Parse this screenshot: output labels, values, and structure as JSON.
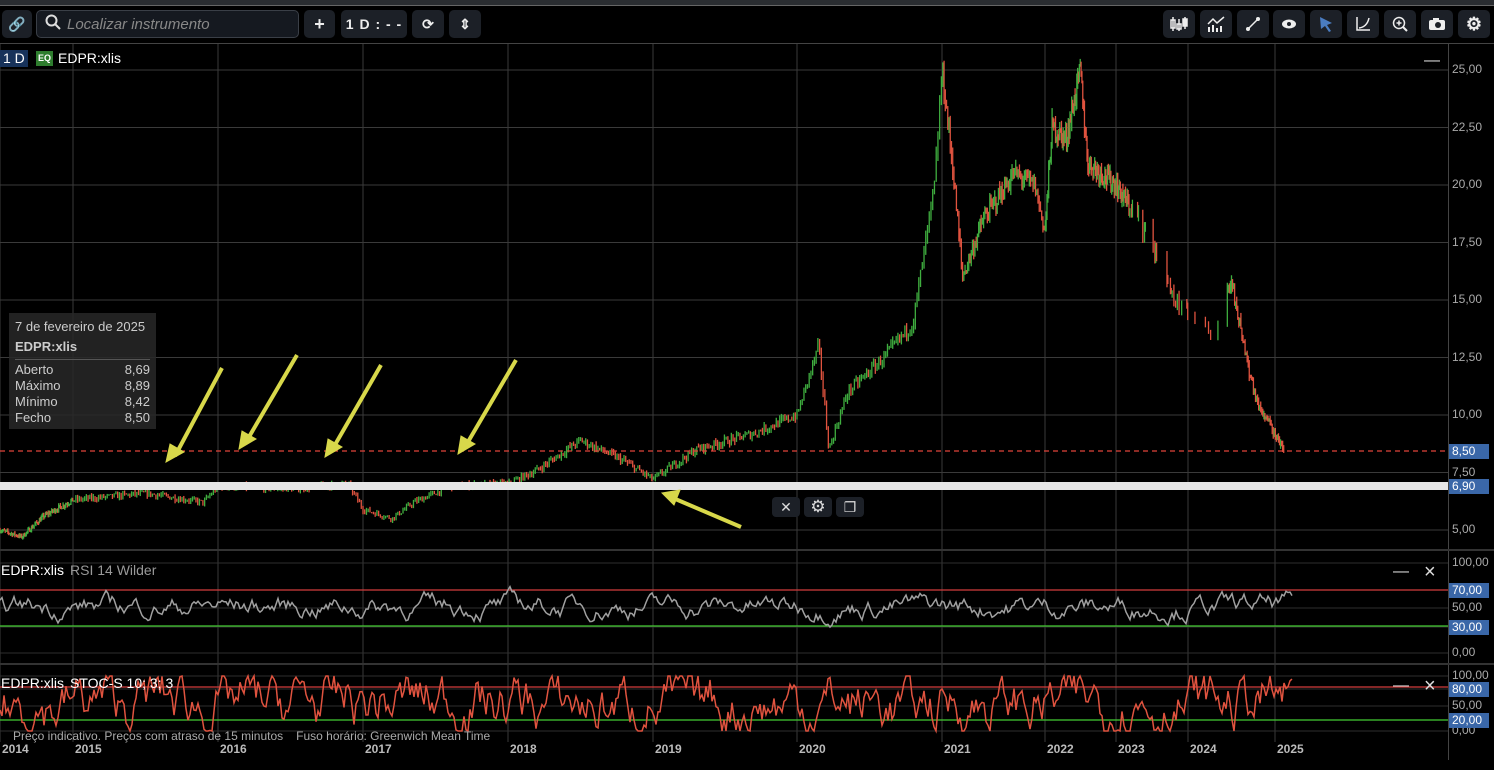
{
  "toolbar": {
    "search_placeholder": "Localizar instrumento",
    "add_label": "+",
    "interval_label": "1 D : - -",
    "icons": [
      "link-icon",
      "search-icon",
      "plus-icon",
      "refresh-icon",
      "expand-vertical-icon",
      "candlestick-icon",
      "indicators-icon",
      "draw-line-icon",
      "eye-icon",
      "cursor-icon",
      "curve-icon",
      "zoom-in-icon",
      "camera-icon",
      "gear-icon"
    ]
  },
  "main": {
    "interval_badge": "1 D",
    "type_badge": "EQ",
    "symbol": "EDPR:xlis",
    "minimize": "—"
  },
  "tooltip": {
    "date": "7 de fevereiro de 2025",
    "symbol": "EDPR:xlis",
    "rows": [
      {
        "label": "Aberto",
        "value": "8,69"
      },
      {
        "label": "Máximo",
        "value": "8,89"
      },
      {
        "label": "Mínimo",
        "value": "8,42"
      },
      {
        "label": "Fecho",
        "value": "8,50"
      }
    ]
  },
  "price_axis": [
    "25,00",
    "22,50",
    "20,00",
    "17,50",
    "15,00",
    "12,50",
    "10,00",
    "7,50",
    "5,00"
  ],
  "badges": {
    "last": "8,50",
    "line": "6,90",
    "rsi_hi": "70,00",
    "rsi_lo": "30,00",
    "stoch_hi": "80,00",
    "stoch_lo": "20,00"
  },
  "rsi": {
    "symbol": "EDPR:xlis",
    "name": "RSI 14 Wilder",
    "axis": [
      "100,00",
      "70,00",
      "50,00",
      "30,00",
      "0,00"
    ],
    "min": "—",
    "close": "×"
  },
  "stoch": {
    "symbol": "EDPR:xlis",
    "name": "STOC-S 10; 3; 3",
    "axis": [
      "100,00",
      "80,00",
      "50,00",
      "20,00",
      "0,00"
    ],
    "min": "—",
    "close": "×"
  },
  "footer": {
    "note": "Preço indicativo. Preços com atraso de 15 minutos",
    "timezone": "Fuso horário: Greenwich Mean Time"
  },
  "years": [
    "2014",
    "2015",
    "2016",
    "2017",
    "2018",
    "2019",
    "2020",
    "2021",
    "2022",
    "2023",
    "2024",
    "2025"
  ],
  "overlay": {
    "close": "✕",
    "settings": "⚙",
    "clone": "❐"
  },
  "colors": {
    "up": "#3fae3f",
    "down": "#e0533f",
    "rsi": "#a0a0a0",
    "stoch": "#e0533f",
    "hi": "#d43c3c",
    "lo": "#44cc33",
    "accent": "#3a67a8"
  },
  "chart_data": {
    "type": "candlestick",
    "symbol": "EDPR:xlis",
    "ylim": [
      4,
      26
    ],
    "price_keypoints": [
      [
        2014.0,
        5.0
      ],
      [
        2014.3,
        4.7
      ],
      [
        2014.6,
        5.6
      ],
      [
        2015.0,
        6.3
      ],
      [
        2015.5,
        6.6
      ],
      [
        2015.9,
        6.2
      ],
      [
        2016.0,
        6.9
      ],
      [
        2016.5,
        6.8
      ],
      [
        2016.9,
        7.0
      ],
      [
        2017.0,
        5.9
      ],
      [
        2017.2,
        5.5
      ],
      [
        2017.35,
        6.2
      ],
      [
        2017.6,
        6.9
      ],
      [
        2018.0,
        7.0
      ],
      [
        2018.2,
        7.6
      ],
      [
        2018.5,
        8.9
      ],
      [
        2018.8,
        8.0
      ],
      [
        2019.0,
        7.2
      ],
      [
        2019.3,
        8.5
      ],
      [
        2019.7,
        9.2
      ],
      [
        2020.0,
        10.0
      ],
      [
        2020.15,
        13.0
      ],
      [
        2020.22,
        8.5
      ],
      [
        2020.35,
        11.0
      ],
      [
        2020.6,
        12.5
      ],
      [
        2020.8,
        14.0
      ],
      [
        2020.95,
        20.0
      ],
      [
        2021.0,
        25.0
      ],
      [
        2021.1,
        21.0
      ],
      [
        2021.2,
        16.0
      ],
      [
        2021.4,
        18.5
      ],
      [
        2021.7,
        20.5
      ],
      [
        2021.9,
        20.0
      ],
      [
        2022.0,
        18.0
      ],
      [
        2022.1,
        22.5
      ],
      [
        2022.3,
        22.0
      ],
      [
        2022.5,
        25.0
      ],
      [
        2022.6,
        21.0
      ],
      [
        2022.8,
        20.5
      ],
      [
        2023.0,
        20.0
      ],
      [
        2023.2,
        19.0
      ],
      [
        2023.5,
        17.5
      ],
      [
        2023.8,
        15.0
      ],
      [
        2024.0,
        14.5
      ],
      [
        2024.3,
        13.5
      ],
      [
        2024.5,
        15.8
      ],
      [
        2024.7,
        12.0
      ],
      [
        2024.8,
        10.5
      ],
      [
        2025.1,
        8.5
      ]
    ],
    "last_close": 8.5,
    "horizontal_line": 6.9,
    "rsi_levels": [
      30,
      70
    ],
    "stoch_levels": [
      20,
      80
    ]
  }
}
